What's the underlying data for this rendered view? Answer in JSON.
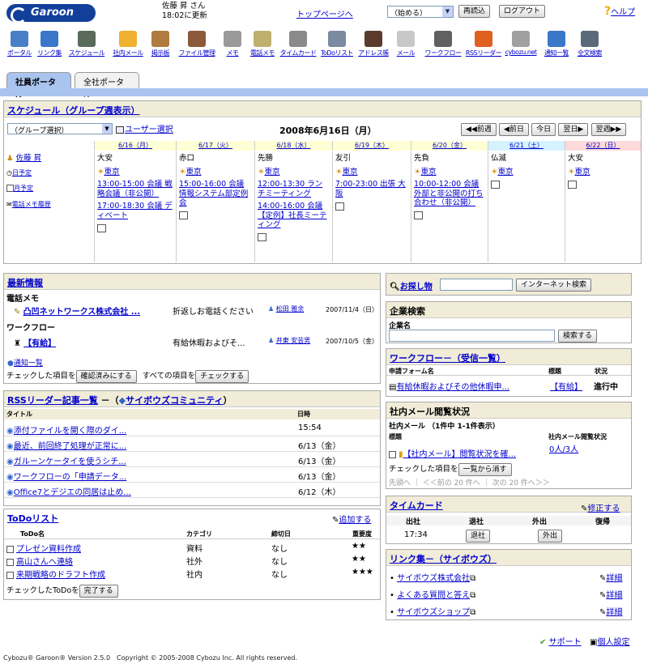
{
  "header": {
    "logo": "Garoon",
    "user_name": "佐藤 昇 さん",
    "update_info": "18:02に更新",
    "top_link": "トップページへ",
    "start_select": "（始める）",
    "reload": "再読込",
    "logout": "ログアウト",
    "help": "ヘルプ"
  },
  "apps": [
    {
      "label": "ポータル",
      "icon": "portal-icon",
      "color": "#4a7fc8"
    },
    {
      "label": "リンク集",
      "icon": "link-globe-icon",
      "color": "#3b77c9"
    },
    {
      "label": "スケジュール",
      "icon": "schedule-icon",
      "color": "#5b6b5b"
    },
    {
      "label": "社内メール",
      "icon": "internal-mail-icon",
      "color": "#f0b030"
    },
    {
      "label": "掲示板",
      "icon": "bulletin-icon",
      "color": "#b07a40"
    },
    {
      "label": "ファイル管理",
      "icon": "file-cabinet-icon",
      "color": "#8a5a3a"
    },
    {
      "label": "メモ",
      "icon": "memo-pen-icon",
      "color": "#9a9a9a"
    },
    {
      "label": "電話メモ",
      "icon": "phone-memo-icon",
      "color": "#c0b070"
    },
    {
      "label": "タイムカード",
      "icon": "timecard-icon",
      "color": "#8a8a8a"
    },
    {
      "label": "ToDoリスト",
      "icon": "todo-icon",
      "color": "#7a8aa0"
    },
    {
      "label": "アドレス帳",
      "icon": "address-book-icon",
      "color": "#5a3a2a"
    },
    {
      "label": "メール",
      "icon": "mail-envelope-icon",
      "color": "#c8c8c8"
    },
    {
      "label": "ワークフロー",
      "icon": "workflow-stamp-icon",
      "color": "#606060"
    },
    {
      "label": "RSSリーダー",
      "icon": "rss-icon",
      "color": "#e06020"
    },
    {
      "label": "cybozu.net",
      "icon": "cybozu-net-icon",
      "color": "#a0a0a0"
    },
    {
      "label": "通知一覧",
      "icon": "notification-icon",
      "color": "#3b77c9"
    },
    {
      "label": "全文検索",
      "icon": "binoculars-icon",
      "color": "#5a6a7a"
    }
  ],
  "tabs": {
    "active": "社員ポータル",
    "other": "全社ポータル"
  },
  "schedule": {
    "title": "スケジュール（グループ週表示）",
    "group_select": "（グループ選択）",
    "user_select": "ユーザー選択",
    "date_title": "2008年6月16日（月）",
    "nav": [
      "前週",
      "前日",
      "今日",
      "翌日",
      "翌週"
    ],
    "user": "佐藤 昇",
    "user_links": [
      "日予定",
      "月予定",
      "電話メモ履歴"
    ],
    "days": [
      {
        "date": "6/16（月）",
        "rokuyo": "大安",
        "loc": "東京",
        "events": [
          "13:00-15:00 会議 戦略会議（非公開）",
          "17:00-18:30 会議 ディベート"
        ],
        "bg": "#ffffd6"
      },
      {
        "date": "6/17（火）",
        "rokuyo": "赤口",
        "loc": "東京",
        "events": [
          "15:00-16:00 会議 情報システム部定例会"
        ],
        "bg": "#ffffd6"
      },
      {
        "date": "6/18（水）",
        "rokuyo": "先勝",
        "loc": "東京",
        "events": [
          "12:00-13:30 ランチミーティング",
          "14:00-16:00 会議【定例】社長ミーティング"
        ],
        "bg": "#ffffd6"
      },
      {
        "date": "6/19（木）",
        "rokuyo": "友引",
        "loc": "東京",
        "events": [
          "7:00-23:00 出張 大阪"
        ],
        "bg": "#ffffd6"
      },
      {
        "date": "6/20（金）",
        "rokuyo": "先負",
        "loc": "東京",
        "events": [
          "10:00-12:00 会議 外部と非公開の打ち合わせ（非公開）"
        ],
        "bg": "#ffffd6"
      },
      {
        "date": "6/21（土）",
        "rokuyo": "仏滅",
        "loc": "東京",
        "events": [],
        "bg": "#d6f2ff"
      },
      {
        "date": "6/22（日）",
        "rokuyo": "大安",
        "loc": "東京",
        "events": [],
        "bg": "#ffdada"
      }
    ]
  },
  "news": {
    "title": "最新情報",
    "sec1": "電話メモ",
    "item1": {
      "title": "凸凹ネットワークス株式会社 ...",
      "text": "折返しお電話ください",
      "person": "松田 雅余",
      "date": "2007/11/4（日）"
    },
    "sec2": "ワークフロー",
    "item2": {
      "title": "【有給】",
      "text": "有給休暇およびそ...",
      "person": "井東 安芸男",
      "date": "2007/10/5（金）"
    },
    "notify": "通知一覧",
    "checked_label": "チェックした項目を",
    "confirm_btn": "確認済みにする",
    "all_label": "すべての項目を",
    "check_btn": "チェックする"
  },
  "rss": {
    "title": "RSSリーダー記事一覧",
    "feed": "サイボウズコミュニティ",
    "col_title": "タイトル",
    "col_date": "日時",
    "rows": [
      {
        "t": "添付ファイルを開く際のダイ...",
        "d": "15:54"
      },
      {
        "t": "最近、前回終了処理が正常に...",
        "d": "6/13（金）"
      },
      {
        "t": "ガルーンケータイを使うシチ...",
        "d": "6/13（金）"
      },
      {
        "t": "ワークフローの「申請データ...",
        "d": "6/13（金）"
      },
      {
        "t": "Office7とデジエの同居は止め...",
        "d": "6/12（木）"
      }
    ]
  },
  "todo": {
    "title": "ToDoリスト",
    "add": "追加する",
    "cols": [
      "ToDo名",
      "カテゴリ",
      "締切日",
      "重要度"
    ],
    "rows": [
      {
        "n": "プレゼン資料作成",
        "c": "資料",
        "d": "なし",
        "p": "★★"
      },
      {
        "n": "高山さんへ連絡",
        "c": "社外",
        "d": "なし",
        "p": "★★"
      },
      {
        "n": "来期戦略のドラフト作成",
        "c": "社内",
        "d": "なし",
        "p": "★★★"
      }
    ],
    "checked_label": "チェックしたToDoを",
    "complete_btn": "完了する"
  },
  "search": {
    "title": "お探し物",
    "btn": "インターネット検索"
  },
  "company": {
    "title": "企業検索",
    "label": "企業名",
    "btn": "検索する"
  },
  "workflow": {
    "title": "ワークフロー－（受信一覧）",
    "cols": [
      "申請フォーム名",
      "標題",
      "状況"
    ],
    "row": {
      "form": "有給休暇およびその他休暇申...",
      "title": "【有給】",
      "status": "進行中"
    }
  },
  "mailstatus": {
    "title": "社内メール閲覧状況",
    "sub": "社内メール （1件中 1-1件表示）",
    "cols": [
      "標題",
      "社内メール閲覧状況"
    ],
    "row": {
      "t": "【社内メール】閲覧状況を確...",
      "s": "0人/3人"
    },
    "checked_label": "チェックした項目を",
    "remove_btn": "一覧から消す",
    "pager": "先頭へ ｜ ＜＜前の 20 件へ ｜ 次の 20 件へ＞＞"
  },
  "timecard": {
    "title": "タイムカード",
    "edit": "修正する",
    "cols": [
      "出社",
      "退社",
      "外出",
      "復帰"
    ],
    "in_time": "17:34",
    "out_btn": "退社",
    "away_btn": "外出"
  },
  "links": {
    "title": "リンク集－（サイボウズ）",
    "items": [
      "サイボウズ株式会社",
      "よくある質問と答え",
      "サイボウズショップ"
    ],
    "detail": "詳細"
  },
  "footer": {
    "support": "サポート",
    "personal": "個人設定",
    "copyright": "Cybozu® Garoon® Version 2.5.0　Copyright © 2005-2008 Cybozu Inc. All rights reserved."
  }
}
